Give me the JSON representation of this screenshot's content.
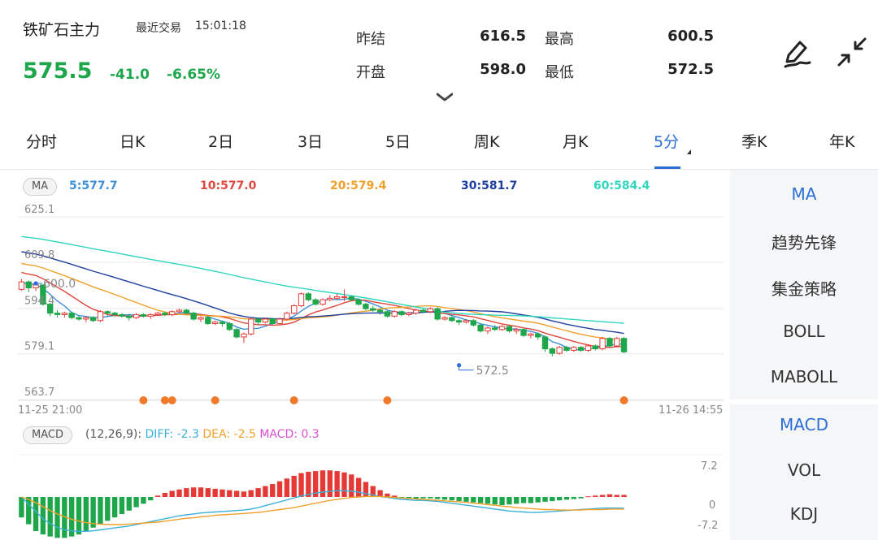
{
  "header": {
    "name": "铁矿石主力",
    "time_label": "最近交易",
    "time": "15:01:18",
    "price": "575.5",
    "change": "-41.0",
    "change_pct": "-6.65%",
    "quotes": [
      {
        "label": "昨结",
        "value": "616.5"
      },
      {
        "label": "最高",
        "value": "600.5"
      },
      {
        "label": "开盘",
        "value": "598.0"
      },
      {
        "label": "最低",
        "value": "572.5"
      }
    ],
    "icons": [
      "chevron-down-icon",
      "pen-draw-icon",
      "collapse-icon"
    ]
  },
  "tabs": [
    {
      "label": "分时"
    },
    {
      "label": "日K"
    },
    {
      "label": "2日"
    },
    {
      "label": "3日"
    },
    {
      "label": "5日"
    },
    {
      "label": "周K"
    },
    {
      "label": "月K"
    },
    {
      "label": "5分",
      "active": true
    },
    {
      "label": "季K"
    },
    {
      "label": "年K"
    }
  ],
  "ma_legend": {
    "badge": "MA",
    "items": [
      {
        "text": "5:577.7",
        "color": "#3d8fd8"
      },
      {
        "text": "10:577.0",
        "color": "#e0463e"
      },
      {
        "text": "20:579.4",
        "color": "#f0a02a"
      },
      {
        "text": "30:581.7",
        "color": "#1f3f9e"
      },
      {
        "text": "60:584.4",
        "color": "#2fd5bf"
      }
    ]
  },
  "macd_legend": {
    "badge": "MACD",
    "params": "(12,26,9):",
    "diff_label": "DIFF: -2.3",
    "dea_label": "DEA: -2.5",
    "macd_label": "MACD: 0.3",
    "diff_color": "#3ab0d8",
    "dea_color": "#f0a02a",
    "macd_color": "#d94fd0"
  },
  "side_menu": {
    "main": [
      {
        "label": "MA",
        "active": true
      },
      {
        "label": "趋势先锋"
      },
      {
        "label": "集金策略"
      },
      {
        "label": "BOLL"
      },
      {
        "label": "MABOLL"
      }
    ],
    "sub": [
      {
        "label": "MACD",
        "active": true
      },
      {
        "label": "VOL"
      },
      {
        "label": "KDJ"
      }
    ]
  },
  "colors": {
    "up": "#e53935",
    "down": "#1ea64a",
    "accent": "#2b6fd6",
    "marker": "#f07a2a"
  },
  "chart_data": {
    "type": "candlestick",
    "y_ticks": [
      "625.1",
      "609.8",
      "594.4",
      "579.1",
      "563.7"
    ],
    "ylim": [
      563.7,
      625.1
    ],
    "x_labels": [
      "11-25 21:00",
      "11-26 14:55"
    ],
    "price_markers": [
      {
        "text": "600.0",
        "value": 600.0,
        "bar": 2
      },
      {
        "text": "572.5",
        "value": 572.5,
        "bar": 61
      }
    ],
    "signal_dots_bars": [
      17,
      20,
      21,
      27,
      38,
      51,
      84
    ],
    "candles": [
      [
        598.0,
        600.5,
        601.5,
        597.5
      ],
      [
        600.5,
        598.5,
        601.0,
        597.0
      ],
      [
        598.5,
        599.5,
        600.5,
        597.5
      ],
      [
        599.5,
        593.0,
        599.5,
        592.5
      ],
      [
        593.0,
        590.0,
        593.5,
        589.0
      ],
      [
        590.0,
        589.5,
        591.0,
        588.5
      ],
      [
        589.5,
        590.0,
        590.5,
        588.5
      ],
      [
        590.0,
        588.5,
        590.5,
        588.0
      ],
      [
        588.5,
        588.0,
        589.0,
        587.5
      ],
      [
        588.0,
        588.5,
        589.0,
        587.0
      ],
      [
        588.5,
        587.5,
        589.0,
        587.0
      ],
      [
        587.5,
        590.5,
        591.0,
        587.0
      ],
      [
        590.5,
        590.0,
        591.0,
        589.0
      ],
      [
        590.0,
        589.5,
        590.5,
        589.0
      ],
      [
        589.5,
        589.0,
        590.0,
        588.5
      ],
      [
        589.0,
        588.5,
        589.5,
        587.5
      ],
      [
        588.5,
        589.5,
        590.0,
        588.0
      ],
      [
        589.5,
        589.0,
        590.0,
        588.5
      ],
      [
        589.0,
        589.5,
        590.0,
        588.0
      ],
      [
        589.5,
        590.0,
        590.5,
        589.0
      ],
      [
        590.0,
        589.5,
        590.5,
        589.0
      ],
      [
        589.5,
        590.5,
        591.0,
        589.0
      ],
      [
        590.5,
        591.0,
        591.5,
        590.0
      ],
      [
        591.0,
        590.0,
        591.5,
        589.5
      ],
      [
        590.0,
        588.0,
        590.5,
        587.5
      ],
      [
        588.0,
        588.5,
        589.0,
        587.0
      ],
      [
        588.5,
        586.5,
        589.0,
        586.0
      ],
      [
        586.5,
        587.0,
        587.5,
        586.0
      ],
      [
        587.0,
        586.5,
        587.5,
        585.5
      ],
      [
        586.5,
        584.5,
        587.0,
        584.0
      ],
      [
        584.5,
        582.0,
        585.0,
        581.5
      ],
      [
        582.0,
        583.0,
        583.5,
        580.0
      ],
      [
        583.0,
        588.0,
        588.5,
        582.5
      ],
      [
        588.0,
        587.0,
        588.5,
        586.0
      ],
      [
        587.0,
        588.0,
        588.5,
        586.5
      ],
      [
        588.0,
        586.5,
        588.5,
        586.0
      ],
      [
        586.5,
        588.0,
        588.5,
        586.0
      ],
      [
        588.0,
        590.0,
        590.5,
        587.5
      ],
      [
        590.0,
        592.5,
        593.0,
        589.5
      ],
      [
        592.5,
        596.5,
        597.0,
        592.0
      ],
      [
        596.5,
        594.5,
        597.0,
        594.0
      ],
      [
        594.5,
        593.0,
        595.0,
        592.5
      ],
      [
        593.0,
        594.5,
        595.0,
        592.5
      ],
      [
        594.5,
        595.0,
        596.0,
        594.0
      ],
      [
        595.0,
        595.5,
        596.5,
        594.5
      ],
      [
        595.5,
        595.5,
        598.0,
        594.0
      ],
      [
        595.5,
        594.5,
        596.0,
        594.0
      ],
      [
        594.5,
        593.0,
        595.0,
        592.5
      ],
      [
        593.0,
        591.5,
        593.5,
        591.0
      ],
      [
        591.5,
        591.0,
        592.5,
        590.5
      ],
      [
        591.0,
        590.5,
        591.5,
        589.5
      ],
      [
        590.5,
        589.0,
        591.0,
        588.5
      ],
      [
        589.0,
        590.5,
        591.0,
        588.5
      ],
      [
        590.5,
        589.5,
        591.0,
        589.0
      ],
      [
        589.5,
        590.0,
        590.5,
        589.0
      ],
      [
        590.0,
        591.0,
        591.5,
        589.5
      ],
      [
        591.0,
        590.5,
        591.5,
        590.0
      ],
      [
        590.5,
        591.5,
        592.0,
        590.0
      ],
      [
        591.5,
        588.0,
        592.0,
        587.5
      ],
      [
        588.0,
        588.5,
        589.0,
        587.5
      ],
      [
        588.5,
        587.5,
        589.0,
        587.0
      ],
      [
        587.5,
        587.0,
        588.0,
        586.0
      ],
      [
        587.0,
        587.5,
        588.0,
        586.5
      ],
      [
        587.5,
        586.0,
        588.0,
        585.5
      ],
      [
        586.0,
        584.0,
        586.5,
        583.5
      ],
      [
        584.0,
        585.0,
        585.5,
        583.0
      ],
      [
        585.0,
        584.5,
        586.0,
        584.0
      ],
      [
        584.5,
        585.5,
        586.0,
        584.0
      ],
      [
        585.5,
        584.0,
        586.0,
        583.5
      ],
      [
        584.0,
        584.5,
        585.0,
        583.0
      ],
      [
        584.5,
        582.5,
        585.0,
        582.0
      ],
      [
        582.5,
        583.0,
        583.5,
        581.5
      ],
      [
        583.0,
        582.0,
        583.5,
        581.0
      ],
      [
        582.0,
        578.0,
        582.5,
        577.0
      ],
      [
        578.0,
        576.5,
        578.5,
        575.5
      ],
      [
        576.5,
        578.5,
        579.0,
        576.0
      ],
      [
        578.5,
        577.5,
        579.0,
        577.0
      ],
      [
        577.5,
        578.5,
        579.0,
        577.0
      ],
      [
        578.5,
        577.5,
        579.0,
        577.0
      ],
      [
        577.5,
        579.0,
        579.5,
        577.0
      ],
      [
        579.0,
        578.0,
        579.5,
        577.5
      ],
      [
        578.0,
        581.5,
        582.0,
        577.5
      ],
      [
        581.5,
        579.0,
        582.0,
        578.5
      ],
      [
        579.0,
        581.5,
        582.0,
        578.5
      ],
      [
        581.5,
        577.0,
        582.0,
        576.5
      ]
    ],
    "macd_ticks": [
      "7.2",
      "0",
      "-7.2"
    ],
    "macd_ylim": [
      -7.2,
      7.2
    ],
    "macd_hist": [
      -3,
      -4,
      -5,
      -5.5,
      -5.8,
      -6,
      -6,
      -5.8,
      -5.5,
      -5,
      -4.5,
      -4,
      -3.5,
      -3,
      -2.5,
      -2,
      -1.5,
      -1,
      -0.5,
      0.2,
      0.6,
      0.9,
      1.1,
      1.3,
      1.4,
      1.4,
      1.3,
      1.2,
      1.1,
      1.0,
      0.9,
      0.8,
      1.0,
      1.3,
      1.6,
      1.9,
      2.3,
      2.7,
      3.1,
      3.5,
      3.7,
      3.8,
      3.9,
      3.9,
      3.8,
      3.6,
      3.3,
      2.8,
      2.2,
      1.6,
      1.0,
      0.5,
      0.2,
      -0.1,
      -0.3,
      -0.3,
      -0.2,
      -0.2,
      -0.3,
      -0.4,
      -0.5,
      -0.6,
      -0.7,
      -0.8,
      -0.9,
      -1.0,
      -1.1,
      -1.2,
      -1.1,
      -1.0,
      -0.9,
      -0.9,
      -0.8,
      -0.7,
      -0.6,
      -0.5,
      -0.4,
      -0.3,
      -0.2,
      0.1,
      0.2,
      0.3,
      0.4,
      0.3,
      0.3
    ],
    "macd_diff": [
      0,
      -1.5,
      -3,
      -4.5,
      -5.5,
      -6.3,
      -6.8,
      -7.0,
      -7.1,
      -7.1,
      -7.0,
      -6.8,
      -6.6,
      -6.4,
      -6.2,
      -6.0,
      -5.7,
      -5.4,
      -5.1,
      -4.8,
      -4.5,
      -4.2,
      -3.9,
      -3.7,
      -3.5,
      -3.3,
      -3.2,
      -3.1,
      -3.0,
      -2.9,
      -2.8,
      -2.7,
      -2.5,
      -2.2,
      -1.8,
      -1.4,
      -1.0,
      -0.6,
      -0.2,
      0.2,
      0.5,
      0.8,
      1.0,
      1.2,
      1.3,
      1.3,
      1.2,
      1.0,
      0.7,
      0.4,
      0.1,
      -0.1,
      -0.3,
      -0.5,
      -0.6,
      -0.7,
      -0.7,
      -0.8,
      -0.9,
      -1.1,
      -1.3,
      -1.5,
      -1.7,
      -1.9,
      -2.1,
      -2.3,
      -2.5,
      -2.7,
      -2.9,
      -3.0,
      -3.1,
      -3.2,
      -3.2,
      -3.1,
      -3.0,
      -2.9,
      -2.8,
      -2.7,
      -2.6,
      -2.5,
      -2.4,
      -2.3,
      -2.3,
      -2.3,
      -2.3
    ],
    "macd_dea": [
      0,
      -0.5,
      -1.2,
      -2.0,
      -2.8,
      -3.5,
      -4.1,
      -4.6,
      -5.0,
      -5.3,
      -5.5,
      -5.6,
      -5.7,
      -5.7,
      -5.7,
      -5.6,
      -5.5,
      -5.4,
      -5.3,
      -5.2,
      -5.0,
      -4.8,
      -4.6,
      -4.4,
      -4.3,
      -4.1,
      -4.0,
      -3.8,
      -3.7,
      -3.6,
      -3.5,
      -3.4,
      -3.3,
      -3.2,
      -3.0,
      -2.8,
      -2.6,
      -2.4,
      -2.2,
      -1.9,
      -1.6,
      -1.3,
      -1.0,
      -0.7,
      -0.5,
      -0.3,
      -0.1,
      0.0,
      0.1,
      0.1,
      0.1,
      0.0,
      -0.1,
      -0.2,
      -0.3,
      -0.4,
      -0.5,
      -0.6,
      -0.7,
      -0.8,
      -0.9,
      -1.0,
      -1.1,
      -1.3,
      -1.4,
      -1.6,
      -1.7,
      -1.9,
      -2.0,
      -2.2,
      -2.3,
      -2.4,
      -2.5,
      -2.6,
      -2.6,
      -2.7,
      -2.7,
      -2.7,
      -2.7,
      -2.6,
      -2.6,
      -2.6,
      -2.5,
      -2.5,
      -2.5
    ]
  }
}
